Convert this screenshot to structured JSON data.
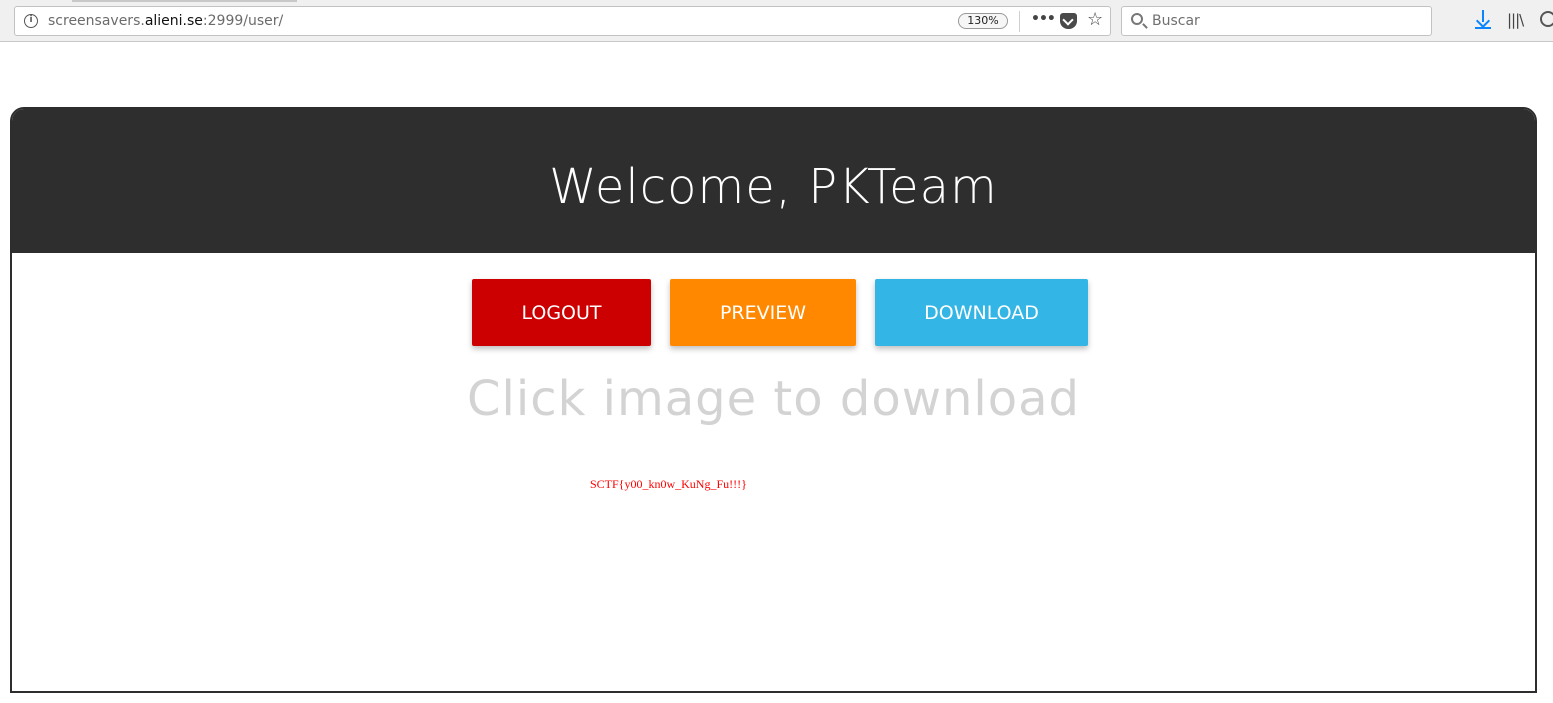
{
  "browser": {
    "url_prefix": "screensavers.",
    "url_host": "alieni.se",
    "url_suffix": ":2999/user/",
    "zoom": "130%",
    "search_placeholder": "Buscar",
    "icons": [
      "info-icon",
      "more-icon",
      "pocket-icon",
      "star-icon",
      "search-icon",
      "download-icon",
      "library-icon",
      "menu-icon"
    ],
    "accent_color": "#0a84ff"
  },
  "page": {
    "welcome": "Welcome, PKTeam",
    "buttons": {
      "logout": "LOGOUT",
      "preview": "PREVIEW",
      "download": "DOWNLOAD"
    },
    "colors": {
      "header": "#2e2e2e",
      "logout": "#cc0000",
      "preview": "#ff8800",
      "download": "#33b5e5"
    },
    "click_hint": "Click image to download",
    "image_text": "SCTF{y00_kn0w_KuNg_Fu!!!}"
  }
}
